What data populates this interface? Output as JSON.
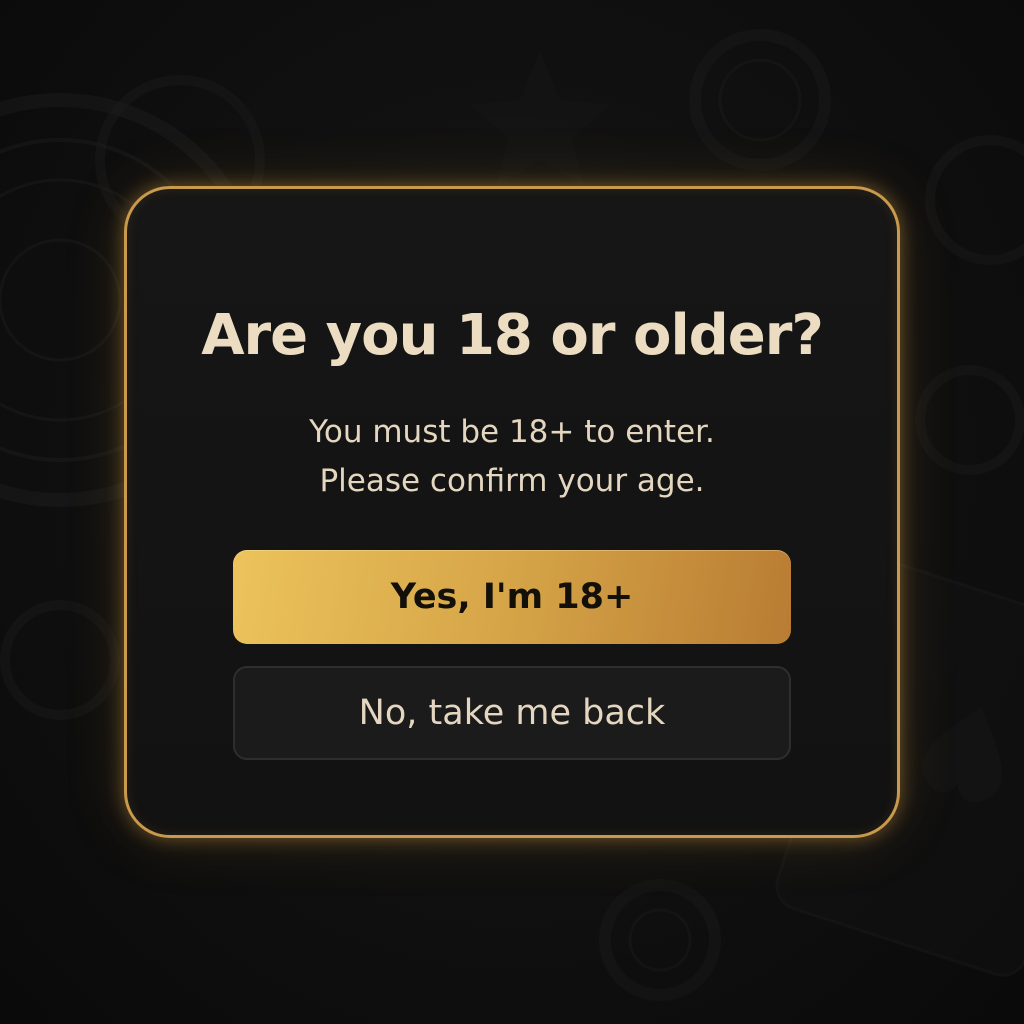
{
  "dialog": {
    "title": "Are you 18 or older?",
    "message_line1": "You must be 18+ to enter.",
    "message_line2": "Please confirm your age.",
    "confirm_label": "Yes, I'm 18+",
    "decline_label": "No, take me back"
  },
  "colors": {
    "accent_gold": "#c99a4b",
    "confirm_gradient_start": "#ecc35c",
    "confirm_gradient_end": "#b97c33",
    "text_cream": "#ecdcc2",
    "background": "#0c0c0c"
  },
  "background_decor": [
    "roulette-wheel-icon",
    "poker-chip-icon",
    "playing-card-icon",
    "star-icon"
  ]
}
